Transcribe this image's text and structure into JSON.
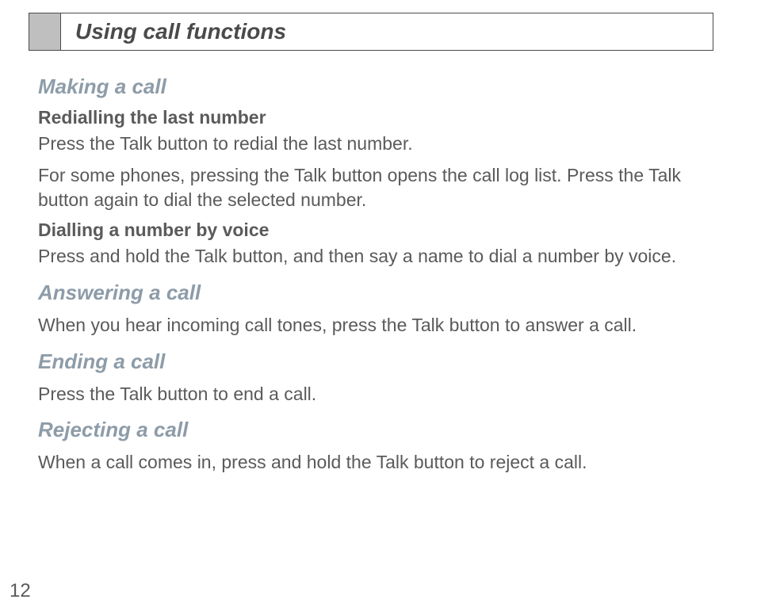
{
  "header": {
    "title": "Using call functions"
  },
  "sections": {
    "making": {
      "heading": "Making a call",
      "redial": {
        "title": "Redialling the last number",
        "p1": "Press the Talk button to redial the last number.",
        "p2": "For some phones, pressing the Talk button opens the call log list. Press the Talk button again to dial the selected number."
      },
      "voice": {
        "title": "Dialling a number by voice",
        "p1": "Press and hold the Talk button, and then say a name to dial a number by voice."
      }
    },
    "answering": {
      "heading": "Answering a call",
      "p1": "When you hear incoming call tones, press the Talk button to answer a call."
    },
    "ending": {
      "heading": "Ending a call",
      "p1": "Press the Talk button to end a call."
    },
    "rejecting": {
      "heading": "Rejecting a call",
      "p1": "When a call comes in, press and hold the Talk button to reject a call."
    }
  },
  "pageNumber": "12"
}
